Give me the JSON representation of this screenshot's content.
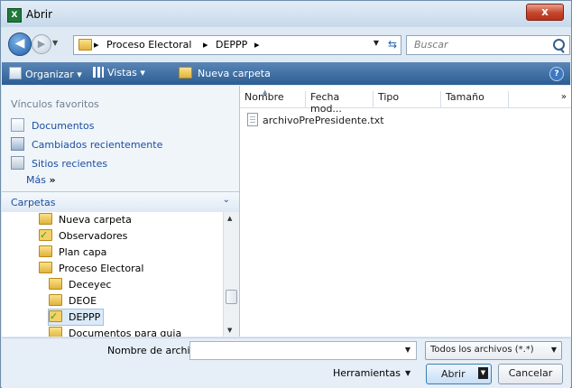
{
  "window": {
    "title": "Abrir",
    "close_glyph": "x"
  },
  "address": {
    "crumbs": [
      "Proceso Electoral",
      "DEPPP"
    ],
    "separator": "▸",
    "search_placeholder": "Buscar"
  },
  "toolbar": {
    "organize": "Organizar",
    "views": "Vistas",
    "new_folder": "Nueva carpeta",
    "help": "?"
  },
  "nav": {
    "favorites_heading": "Vínculos favoritos",
    "favorites": [
      "Documentos",
      "Cambiados recientemente",
      "Sitios recientes"
    ],
    "more": "Más",
    "more_glyph": "»",
    "folders_heading": "Carpetas",
    "tree": [
      {
        "label": "Nueva carpeta",
        "icon": "folder-icon"
      },
      {
        "label": "Observadores",
        "icon": "shared-folder-icon"
      },
      {
        "label": "Plan capa",
        "icon": "folder-icon"
      },
      {
        "label": "Proceso Electoral",
        "icon": "folder-icon"
      },
      {
        "label": "Deceyec",
        "icon": "folder-icon"
      },
      {
        "label": "DEOE",
        "icon": "folder-icon"
      },
      {
        "label": "DEPPP",
        "icon": "shared-folder-icon",
        "selected": true
      },
      {
        "label": "Documentos para guia",
        "icon": "folder-icon"
      }
    ]
  },
  "columns": [
    "Nombre",
    "Fecha mod...",
    "Tipo",
    "Tamaño"
  ],
  "columns_more": "»",
  "files": [
    "archivoPrePresidente.txt"
  ],
  "bottom": {
    "filename_label": "Nombre de archivo:",
    "filename_value": "",
    "filetype": "Todos los archivos (*.*)",
    "tools": "Herramientas",
    "open": "Abrir",
    "cancel": "Cancelar"
  }
}
